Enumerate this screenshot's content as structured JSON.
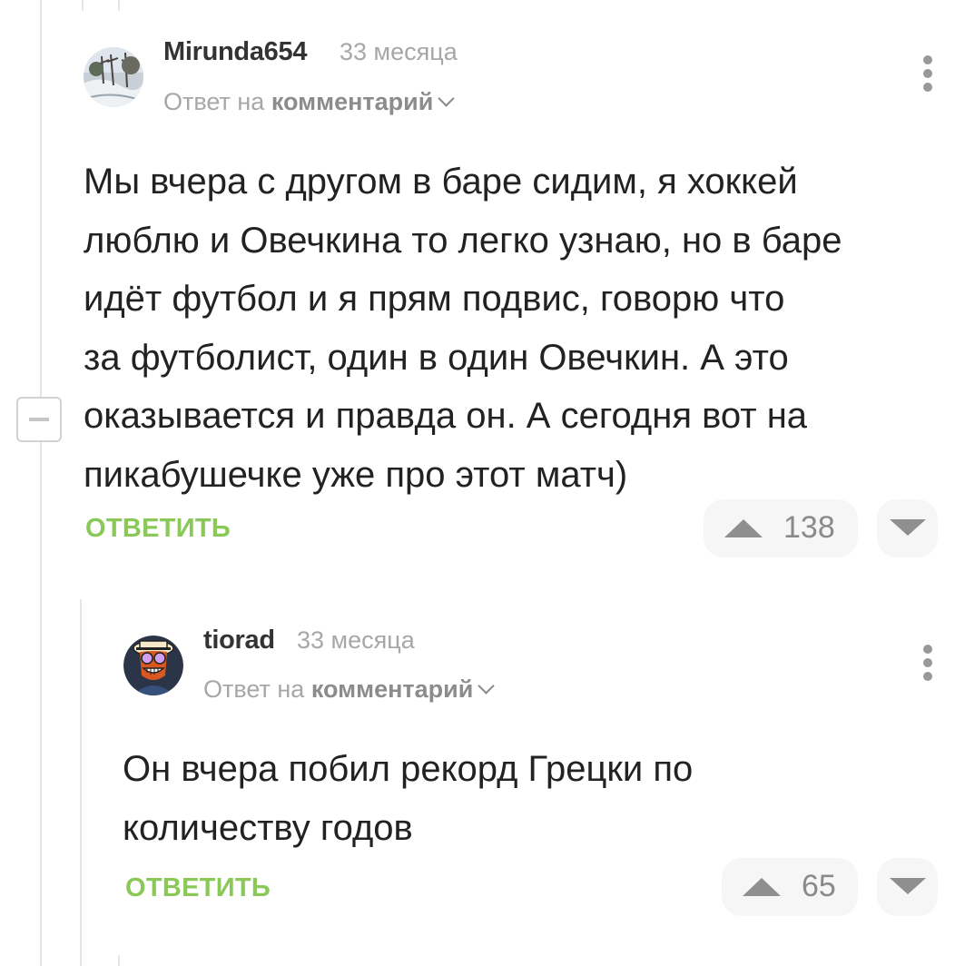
{
  "comments": [
    {
      "author": "Mirunda654",
      "time": "33 месяца",
      "reply_prefix": "Ответ на",
      "reply_target": "комментарий",
      "text": "Мы вчера с другом в баре сидим, я хоккей\nлюблю и Овечкина то легко узнаю, но в баре\nидёт футбол и я прям подвис, говорю что\nза футболист, один в один Овечкин. А это\nоказывается и правда он. А сегодня вот на\nпикабушечке уже про этот матч)",
      "reply_label": "ОТВЕТИТЬ",
      "rating": "138"
    },
    {
      "author": "tiorad",
      "time": "33 месяца",
      "reply_prefix": "Ответ на",
      "reply_target": "комментарий",
      "text": "Он вчера побил рекорд Грецки по\nколичеству годов",
      "reply_label": "ОТВЕТИТЬ",
      "rating": "65"
    }
  ],
  "icons": {
    "upvote": "triangle-up-icon",
    "downvote": "triangle-down-icon",
    "menu": "more-vertical-icon",
    "collapse": "minus-icon",
    "chevron": "chevron-down-icon"
  },
  "colors": {
    "reply_green": "#8ac858",
    "vote_bg": "#f6f6f6",
    "meta_gray": "#a7a7a7"
  }
}
